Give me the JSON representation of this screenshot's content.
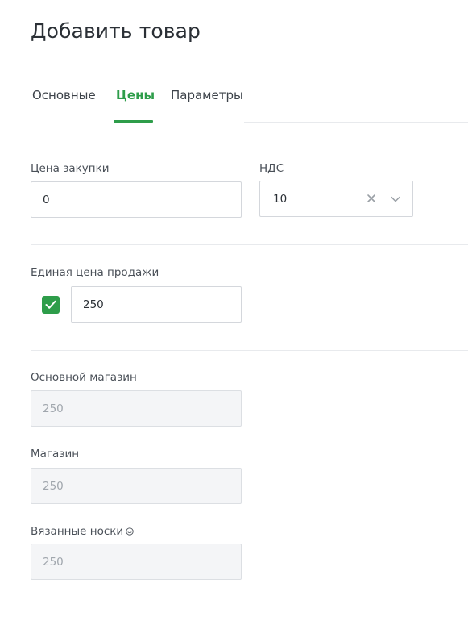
{
  "page": {
    "title": "Добавить товар"
  },
  "tabs": [
    {
      "label": "Основные",
      "active": false
    },
    {
      "label": "Цены",
      "active": true
    },
    {
      "label": "Параметры",
      "active": false
    }
  ],
  "purchase": {
    "label": "Цена закупки",
    "value": "0"
  },
  "vat": {
    "label": "НДС",
    "value": "10",
    "clear_icon": "close-icon",
    "dropdown_icon": "chevron-down-icon"
  },
  "single_price": {
    "label": "Единая цена продажи",
    "checked": true,
    "value": "250"
  },
  "stores": [
    {
      "label": "Основной магазин",
      "value": "250"
    },
    {
      "label": "Магазин",
      "value": "250"
    },
    {
      "label": "Вязанные носки",
      "value": "250",
      "icon": "smile-icon"
    }
  ],
  "colors": {
    "accent": "#2e9d4a",
    "border": "#d4d7dc",
    "disabled_bg": "#f4f5f7"
  }
}
